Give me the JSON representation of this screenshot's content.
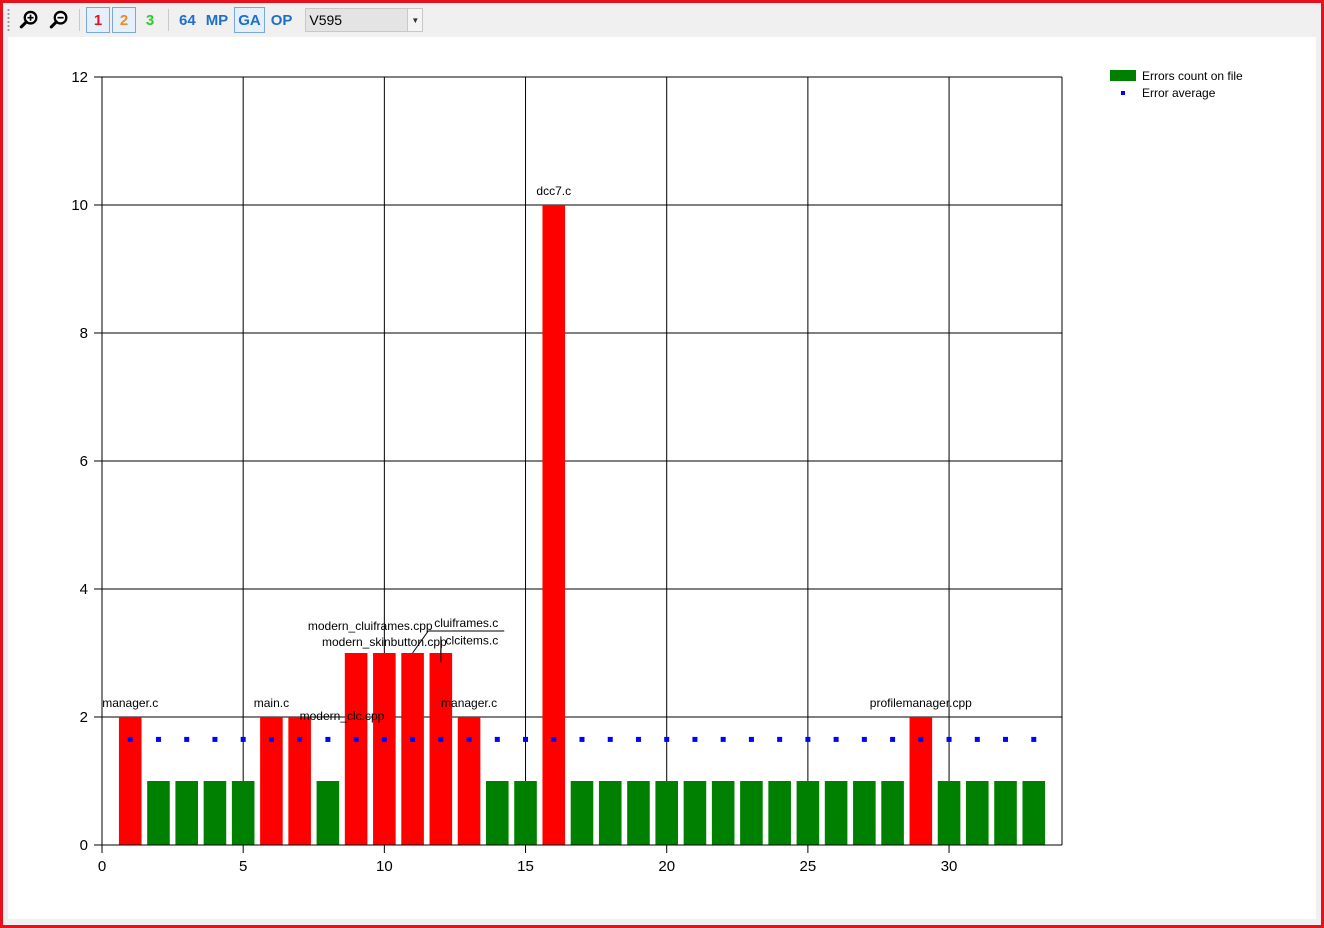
{
  "toolbar": {
    "zoom_in_icon": "zoom-in-icon",
    "zoom_out_icon": "zoom-out-icon",
    "level1_label": "1",
    "level2_label": "2",
    "level3_label": "3",
    "btn_64_label": "64",
    "btn_mp_label": "MP",
    "btn_ga_label": "GA",
    "btn_op_label": "OP",
    "diagnostic_select_value": "V595",
    "colors": {
      "level1": "#e8101a",
      "level2": "#f08a1c",
      "level3": "#2ecc2e",
      "blue": "#1e6fc8"
    }
  },
  "chart_data": {
    "type": "bar",
    "xlim": [
      0,
      34
    ],
    "ylim": [
      0,
      12
    ],
    "xticks": [
      0,
      5,
      10,
      15,
      20,
      25,
      30
    ],
    "yticks": [
      0,
      2,
      4,
      6,
      8,
      10,
      12
    ],
    "grid": true,
    "legend_position": "top-right",
    "series": [
      {
        "name": "Errors count on file",
        "color": "#008000",
        "highlight_color": "#ff0000",
        "x": [
          1,
          2,
          3,
          4,
          5,
          6,
          7,
          8,
          9,
          10,
          11,
          12,
          13,
          14,
          15,
          16,
          17,
          18,
          19,
          20,
          21,
          22,
          23,
          24,
          25,
          26,
          27,
          28,
          29,
          30,
          31,
          32,
          33
        ],
        "values": [
          2,
          1,
          1,
          1,
          1,
          2,
          2,
          1,
          3,
          3,
          3,
          3,
          2,
          1,
          1,
          10,
          1,
          1,
          1,
          1,
          1,
          1,
          1,
          1,
          1,
          1,
          1,
          1,
          2,
          1,
          1,
          1,
          1
        ]
      },
      {
        "name": "Error average",
        "color": "#0000ff",
        "type": "scatter",
        "x": [
          1,
          2,
          3,
          4,
          5,
          6,
          7,
          8,
          9,
          10,
          11,
          12,
          13,
          14,
          15,
          16,
          17,
          18,
          19,
          20,
          21,
          22,
          23,
          24,
          25,
          26,
          27,
          28,
          29,
          30,
          31,
          32,
          33
        ],
        "values": [
          1.65,
          1.65,
          1.65,
          1.65,
          1.65,
          1.65,
          1.65,
          1.65,
          1.65,
          1.65,
          1.65,
          1.65,
          1.65,
          1.65,
          1.65,
          1.65,
          1.65,
          1.65,
          1.65,
          1.65,
          1.65,
          1.65,
          1.65,
          1.65,
          1.65,
          1.65,
          1.65,
          1.65,
          1.65,
          1.65,
          1.65,
          1.65,
          1.65
        ]
      }
    ],
    "annotations": [
      {
        "text": "manager.c",
        "x": 1,
        "y": 2
      },
      {
        "text": "main.c",
        "x": 6,
        "y": 2
      },
      {
        "text": "modern_clc.cpp",
        "x": 8.5,
        "y": 1.8
      },
      {
        "text": "modern_cluiframes.cpp",
        "x": 9.5,
        "y": 3.2
      },
      {
        "text": "cluiframes.c",
        "x": 12.9,
        "y": 3.25
      },
      {
        "text": "modern_skinbutton.cpp",
        "x": 10,
        "y": 2.95
      },
      {
        "text": "clcitems.c",
        "x": 13.1,
        "y": 2.98
      },
      {
        "text": "manager.c",
        "x": 13.0,
        "y": 2
      },
      {
        "text": "dcc7.c",
        "x": 16,
        "y": 10
      },
      {
        "text": "profilemanager.cpp",
        "x": 29,
        "y": 2
      }
    ]
  }
}
